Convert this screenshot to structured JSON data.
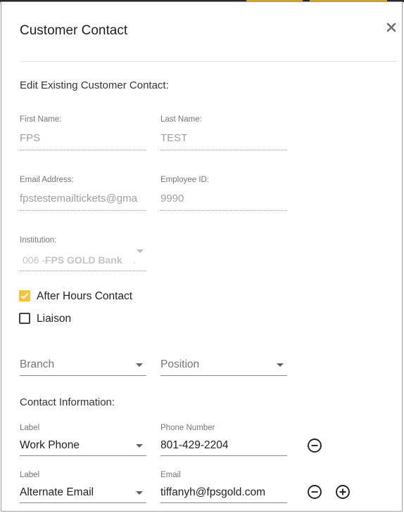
{
  "dialog": {
    "title": "Customer Contact",
    "close_glyph": "×",
    "section_edit": "Edit Existing Customer Contact:",
    "section_contact": "Contact Information:"
  },
  "fields": {
    "first_name": {
      "label": "First Name:",
      "value": "FPS"
    },
    "last_name": {
      "label": "Last Name:",
      "value": "TEST"
    },
    "email": {
      "label": "Email Address:",
      "value": "fpstestemailtickets@gma"
    },
    "employee_id": {
      "label": "Employee ID:",
      "value": "9990"
    },
    "institution": {
      "label": "Institution:",
      "code": "006 -",
      "name": "FPS GOLD Bank",
      "trail": "."
    }
  },
  "checkboxes": {
    "after_hours": {
      "label": "After Hours Contact",
      "checked": true
    },
    "liaison": {
      "label": "Liaison",
      "checked": false
    }
  },
  "selects": {
    "branch": {
      "placeholder": "Branch"
    },
    "position": {
      "placeholder": "Position"
    }
  },
  "contacts": [
    {
      "label_caption": "Label",
      "label_value": "Work Phone",
      "field_caption": "Phone Number",
      "field_value": "801-429-2204"
    },
    {
      "label_caption": "Label",
      "label_value": "Alternate Email",
      "field_caption": "Email",
      "field_value": "tiffanyh@fpsgold.com"
    }
  ],
  "icons": {
    "close": "close-icon",
    "remove": "remove-circle-icon",
    "add": "add-circle-icon",
    "dropdown": "chevron-down-icon",
    "check": "check-icon"
  },
  "colors": {
    "checkbox_checked": "#f5c342",
    "text_primary": "#212121",
    "text_disabled": "#9e9e9e"
  }
}
